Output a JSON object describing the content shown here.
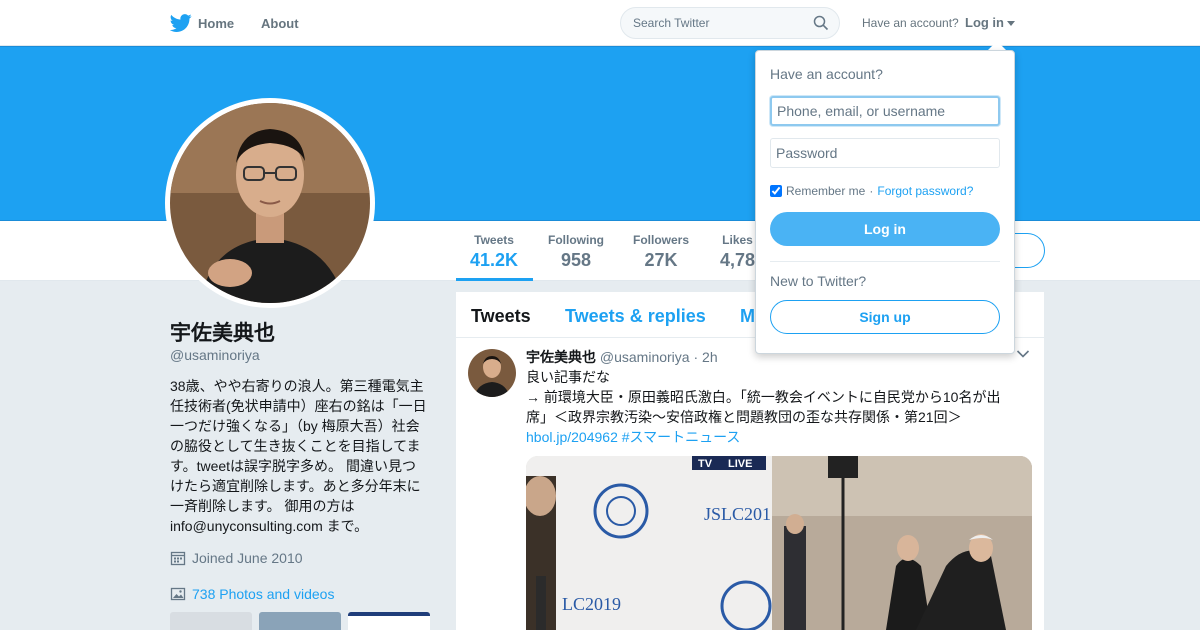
{
  "nav": {
    "home_label": "Home",
    "about_label": "About",
    "search_placeholder": "Search Twitter",
    "have_account": "Have an account?",
    "login_label": "Log in"
  },
  "colors": {
    "brand": "#1da1f2",
    "banner": "#1da1f2",
    "page_bg": "#e6ecf0"
  },
  "profile": {
    "name": "宇佐美典也",
    "handle": "@usaminoriya",
    "bio_lines": [
      "38歳、やや右寄りの浪人。第三種電気主",
      "任技術者(免状申請中）座右の銘は「一日",
      "一つだけ強くなる」（by 梅原大吾）社会",
      "の脇役として生き抜くことを目指してま",
      "す。tweetは誤字脱字多め。 間違い見つ",
      "けたら適宜削除します。あと多分年末に",
      "一斉削除します。 御用の方は",
      "info@unyconsulting.com まで。"
    ],
    "joined": "Joined June 2010",
    "photos_link": "738 Photos and videos"
  },
  "stats": [
    {
      "label": "Tweets",
      "value": "41.2K"
    },
    {
      "label": "Following",
      "value": "958"
    },
    {
      "label": "Followers",
      "value": "27K"
    },
    {
      "label": "Likes",
      "value": "4,78"
    }
  ],
  "timeline": {
    "tabs": [
      "Tweets",
      "Tweets & replies",
      "M"
    ],
    "tweet": {
      "name": "宇佐美典也",
      "handle": "@usaminoriya",
      "separator": "·",
      "time": "2h",
      "line1": "良い記事だな",
      "line2": "→ 前環境大臣・原田義昭氏激白。「統一教会イベントに自民党から10名が出",
      "line3": "席」＜政界宗教汚染〜安倍政権と問題教団の歪な共存関係・第21回＞",
      "link": "hbol.jp/204962",
      "hashtag": "#スマートニュース",
      "media_texts": {
        "tv": "TV",
        "live": "LIVE",
        "jslc": "JSLC201",
        "lc2019": "LC2019"
      }
    }
  },
  "login_dropdown": {
    "title": "Have an account?",
    "username_placeholder": "Phone, email, or username",
    "password_placeholder": "Password",
    "remember_me": "Remember me",
    "separator": "·",
    "forgot": "Forgot password?",
    "login_button": "Log in",
    "new_to_twitter": "New to Twitter?",
    "signup_button": "Sign up"
  }
}
